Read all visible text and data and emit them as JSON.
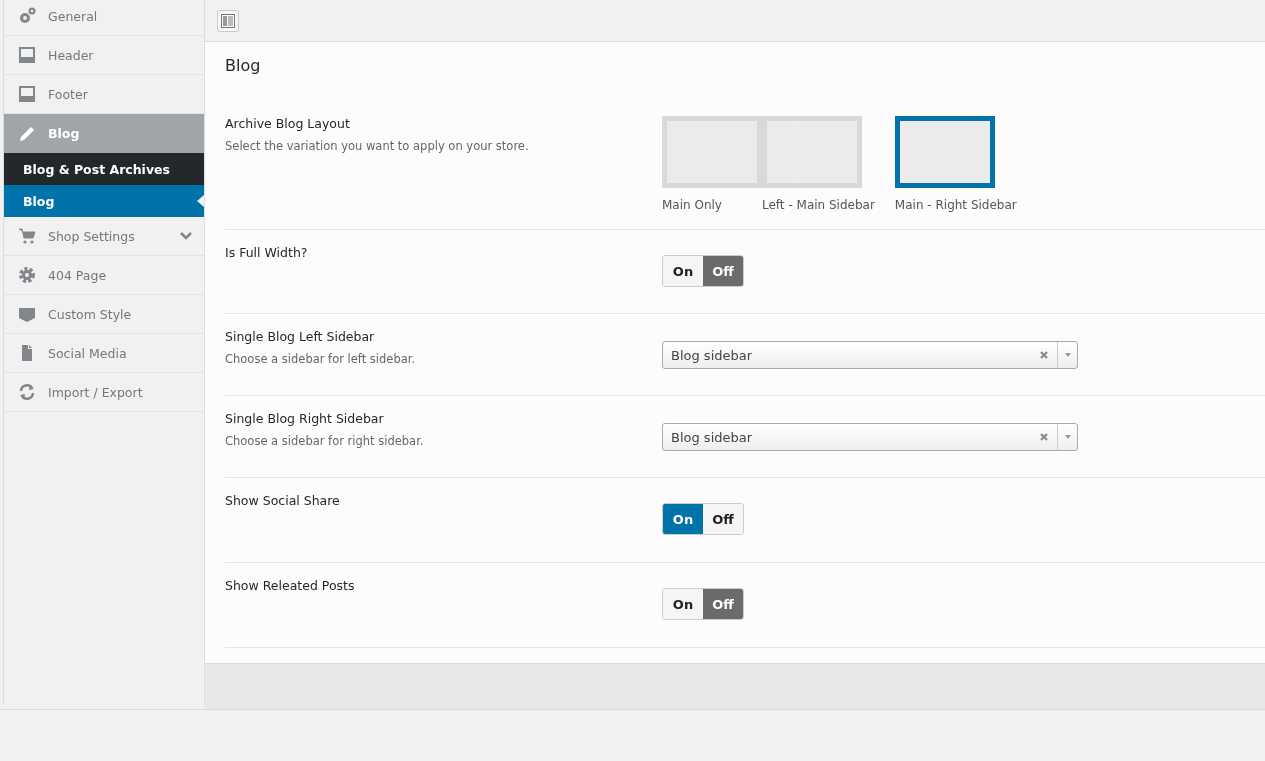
{
  "sidebar": {
    "items": [
      {
        "label": "General",
        "kind": "link",
        "selected": false
      },
      {
        "label": "Header",
        "kind": "link",
        "selected": false
      },
      {
        "label": "Footer",
        "kind": "link",
        "selected": false
      },
      {
        "label": "Blog",
        "kind": "link",
        "selected": true,
        "children": [
          {
            "label": "Blog & Post Archives",
            "selected": false
          },
          {
            "label": "Blog",
            "selected": true
          }
        ]
      },
      {
        "label": "Shop Settings",
        "kind": "group",
        "selected": false
      },
      {
        "label": "404 Page",
        "kind": "link",
        "selected": false
      },
      {
        "label": "Custom Style",
        "kind": "link",
        "selected": false
      },
      {
        "label": "Social Media",
        "kind": "link",
        "selected": false
      },
      {
        "label": "Import / Export",
        "kind": "link",
        "selected": false
      }
    ]
  },
  "section": {
    "title": "Blog",
    "settings": [
      {
        "kind": "layout",
        "title": "Archive Blog Layout",
        "description": "Select the variation you want to apply on your store.",
        "options": [
          {
            "label": "Main Only",
            "selected": false
          },
          {
            "label": "Left - Main Sidebar",
            "selected": false
          },
          {
            "label": "Main - Right Sidebar",
            "selected": true
          }
        ]
      },
      {
        "kind": "toggle",
        "title": "Is Full Width?",
        "on_label": "On",
        "off_label": "Off",
        "on": false
      },
      {
        "kind": "select",
        "title": "Single Blog Left Sidebar",
        "description": "Choose a sidebar for left sidebar.",
        "value": "Blog sidebar"
      },
      {
        "kind": "select",
        "title": "Single Blog Right Sidebar",
        "description": "Choose a sidebar for right sidebar.",
        "value": "Blog sidebar"
      },
      {
        "kind": "toggle",
        "title": "Show Social Share",
        "on_label": "On",
        "off_label": "Off",
        "on": true
      },
      {
        "kind": "toggle",
        "title": "Show Releated Posts",
        "on_label": "On",
        "off_label": "Off",
        "on": false
      }
    ]
  }
}
